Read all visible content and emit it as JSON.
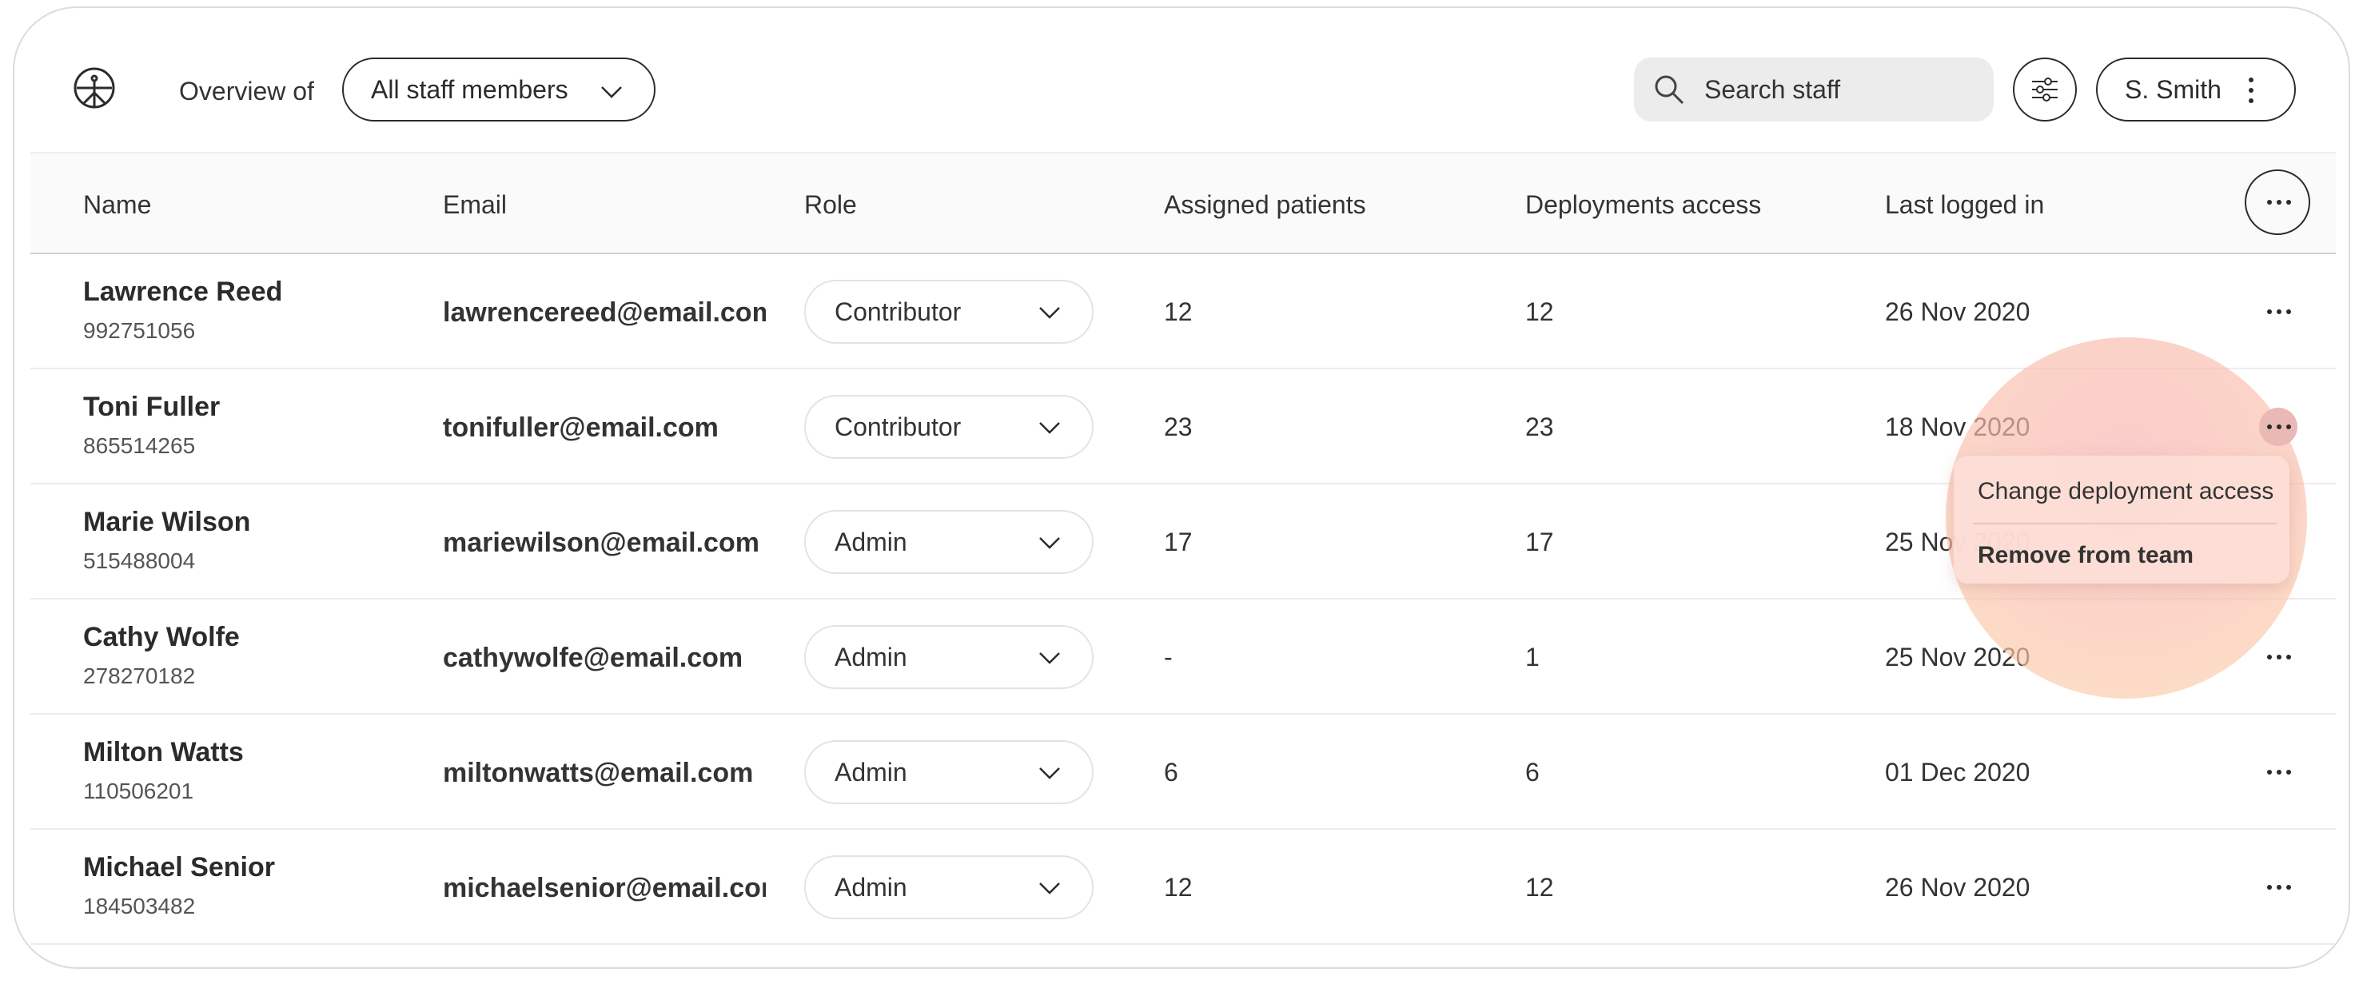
{
  "header": {
    "overview_label": "Overview of",
    "scope_value": "All staff members",
    "search_placeholder": "Search staff",
    "user_name": "S. Smith"
  },
  "table": {
    "columns": [
      "Name",
      "Email",
      "Role",
      "Assigned patients",
      "Deployments access",
      "Last logged in"
    ],
    "rows": [
      {
        "name": "Lawrence Reed",
        "id": "992751056",
        "email": "lawrencereed@email.com",
        "role": "Contributor",
        "assigned": "12",
        "deployments": "12",
        "last_login": "26 Nov 2020"
      },
      {
        "name": "Toni Fuller",
        "id": "865514265",
        "email": "tonifuller@email.com",
        "role": "Contributor",
        "assigned": "23",
        "deployments": "23",
        "last_login": "18 Nov 2020"
      },
      {
        "name": "Marie Wilson",
        "id": "515488004",
        "email": "mariewilson@email.com",
        "role": "Admin",
        "assigned": "17",
        "deployments": "17",
        "last_login": "25 Nov 2020"
      },
      {
        "name": "Cathy Wolfe",
        "id": "278270182",
        "email": "cathywolfe@email.com",
        "role": "Admin",
        "assigned": "-",
        "deployments": "1",
        "last_login": "25 Nov 2020"
      },
      {
        "name": "Milton Watts",
        "id": "110506201",
        "email": "miltonwatts@email.com",
        "role": "Admin",
        "assigned": "6",
        "deployments": "6",
        "last_login": "01 Dec 2020"
      },
      {
        "name": "Michael Senior",
        "id": "184503482",
        "email": "michaelsenior@email.com",
        "role": "Admin",
        "assigned": "12",
        "deployments": "12",
        "last_login": "26 Nov 2020"
      }
    ]
  },
  "row_menu": {
    "items": [
      "Change deployment access",
      "Remove from team"
    ]
  },
  "icons": {
    "logo": "logo-icon",
    "search": "search-icon",
    "filter": "filter-sliders-icon",
    "more": "more-horizontal-icon",
    "kebab": "more-vertical-icon",
    "chevron": "chevron-down-icon"
  },
  "colors": {
    "accent_glow": "#f7bab8",
    "menu_bg": "#fcded7",
    "active_dot_bg": "#e9b9b5"
  }
}
